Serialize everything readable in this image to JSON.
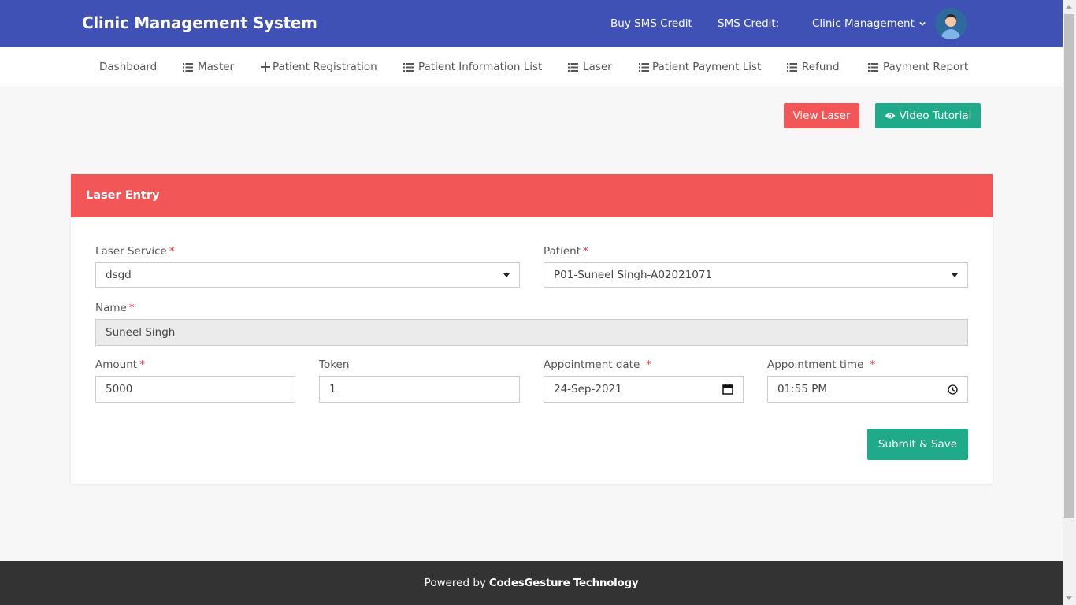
{
  "header": {
    "brand": "Clinic Management System",
    "buy_sms": "Buy SMS Credit",
    "sms_credit": "SMS Credit:",
    "user_menu": "Clinic Management"
  },
  "nav": [
    {
      "label": "Dashboard",
      "icon": ""
    },
    {
      "label": "Master",
      "icon": "list-icon"
    },
    {
      "label": "Patient Registration",
      "icon": "plus-icon"
    },
    {
      "label": "Patient Information List",
      "icon": "list-icon"
    },
    {
      "label": "Laser",
      "icon": "list-icon"
    },
    {
      "label": "Patient Payment List",
      "icon": "list-icon"
    },
    {
      "label": "Refund",
      "icon": "list-icon"
    },
    {
      "label": "Payment Report",
      "icon": "list-icon"
    }
  ],
  "actions": {
    "view_laser": "View Laser",
    "video_tutorial": "Video Tutorial"
  },
  "form": {
    "title": "Laser Entry",
    "laser_service_label": "Laser Service",
    "laser_service_value": "dsgd",
    "patient_label": "Patient",
    "patient_value": "P01-Suneel Singh-A02021071",
    "name_label": "Name",
    "name_value": "Suneel Singh",
    "amount_label": "Amount",
    "amount_value": "5000",
    "token_label": "Token",
    "token_value": "1",
    "date_label": "Appointment date",
    "date_value": "24-Sep-2021",
    "time_label": "Appointment time",
    "time_value": "01:55 PM",
    "required_mark": "*",
    "submit": "Submit & Save"
  },
  "footer": {
    "prefix": "Powered by",
    "company": "CodesGesture Technology"
  },
  "colors": {
    "header_bg": "#3f51b5",
    "danger": "#f25657",
    "success": "#1fab89",
    "footer_bg": "#333333"
  }
}
